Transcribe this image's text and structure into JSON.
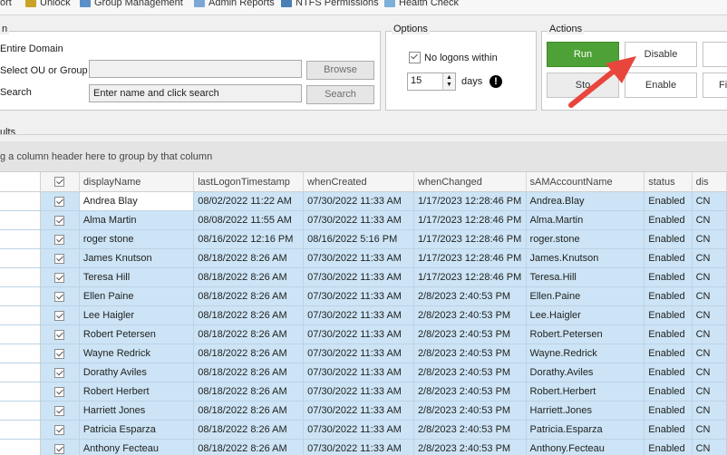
{
  "tabs": [
    {
      "label": "ort",
      "icon": "report-icon"
    },
    {
      "label": "Unlock",
      "icon": "lock-icon"
    },
    {
      "label": "Group Management",
      "icon": "group-icon"
    },
    {
      "label": "Admin Reports",
      "icon": "report-icon"
    },
    {
      "label": "NTFS Permissions",
      "icon": "folder-icon"
    },
    {
      "label": "Health Check",
      "icon": "health-icon"
    }
  ],
  "scope": {
    "group_label": "n",
    "entire_domain": "Entire Domain",
    "select_ou": "Select OU or Group",
    "search_label": "Search",
    "ou_value": "",
    "search_placeholder": "Enter name and click search",
    "browse_button": "Browse",
    "search_button": "Search"
  },
  "options": {
    "group_label": "Options",
    "no_logons_label": "No logons within",
    "no_logons_checked": true,
    "days_value": "15",
    "days_label": "days"
  },
  "actions": {
    "group_label": "Actions",
    "run": "Run",
    "disable": "Disable",
    "stop": "Sto",
    "enable": "Enable",
    "fi": "Fi",
    "run_color": "#4ea136"
  },
  "results": {
    "label": "ults",
    "group_hint": "g a column header here to group by that column",
    "columns": [
      "displayName",
      "lastLogonTimestamp",
      "whenCreated",
      "whenChanged",
      "sAMAccountName",
      "status",
      "dis"
    ],
    "rows": [
      [
        "Andrea Blay",
        "08/02/2022 11:22 AM",
        "07/30/2022 11:33 AM",
        "1/17/2023 12:28:46 PM",
        "Andrea.Blay",
        "Enabled",
        "CN"
      ],
      [
        "Alma Martin",
        "08/08/2022 11:55 AM",
        "07/30/2022 11:33 AM",
        "1/17/2023 12:28:46 PM",
        "Alma.Martin",
        "Enabled",
        "CN"
      ],
      [
        "roger stone",
        "08/16/2022 12:16 PM",
        "08/16/2022 5:16 PM",
        "1/17/2023 12:28:46 PM",
        "roger.stone",
        "Enabled",
        "CN"
      ],
      [
        "James Knutson",
        "08/18/2022 8:26 AM",
        "07/30/2022 11:33 AM",
        "1/17/2023 12:28:46 PM",
        "James.Knutson",
        "Enabled",
        "CN"
      ],
      [
        "Teresa Hill",
        "08/18/2022 8:26 AM",
        "07/30/2022 11:33 AM",
        "1/17/2023 12:28:46 PM",
        "Teresa.Hill",
        "Enabled",
        "CN"
      ],
      [
        "Ellen Paine",
        "08/18/2022 8:26 AM",
        "07/30/2022 11:33 AM",
        "2/8/2023 2:40:53 PM",
        "Ellen.Paine",
        "Enabled",
        "CN"
      ],
      [
        "Lee Haigler",
        "08/18/2022 8:26 AM",
        "07/30/2022 11:33 AM",
        "2/8/2023 2:40:53 PM",
        "Lee.Haigler",
        "Enabled",
        "CN"
      ],
      [
        "Robert Petersen",
        "08/18/2022 8:26 AM",
        "07/30/2022 11:33 AM",
        "2/8/2023 2:40:53 PM",
        "Robert.Petersen",
        "Enabled",
        "CN"
      ],
      [
        "Wayne Redrick",
        "08/18/2022 8:26 AM",
        "07/30/2022 11:33 AM",
        "2/8/2023 2:40:53 PM",
        "Wayne.Redrick",
        "Enabled",
        "CN"
      ],
      [
        "Dorathy Aviles",
        "08/18/2022 8:26 AM",
        "07/30/2022 11:33 AM",
        "2/8/2023 2:40:53 PM",
        "Dorathy.Aviles",
        "Enabled",
        "CN"
      ],
      [
        "Robert Herbert",
        "08/18/2022 8:26 AM",
        "07/30/2022 11:33 AM",
        "2/8/2023 2:40:53 PM",
        "Robert.Herbert",
        "Enabled",
        "CN"
      ],
      [
        "Harriett Jones",
        "08/18/2022 8:26 AM",
        "07/30/2022 11:33 AM",
        "2/8/2023 2:40:53 PM",
        "Harriett.Jones",
        "Enabled",
        "CN"
      ],
      [
        "Patricia Esparza",
        "08/18/2022 8:26 AM",
        "07/30/2022 11:33 AM",
        "2/8/2023 2:40:53 PM",
        "Patricia.Esparza",
        "Enabled",
        "CN"
      ],
      [
        "Anthony Fecteau",
        "08/18/2022 8:26 AM",
        "07/30/2022 11:33 AM",
        "2/8/2023 2:40:53 PM",
        "Anthony.Fecteau",
        "Enabled",
        "CN"
      ]
    ]
  },
  "colors": {
    "selected_row": "#cce4f5",
    "arrow": "#e8453c"
  }
}
